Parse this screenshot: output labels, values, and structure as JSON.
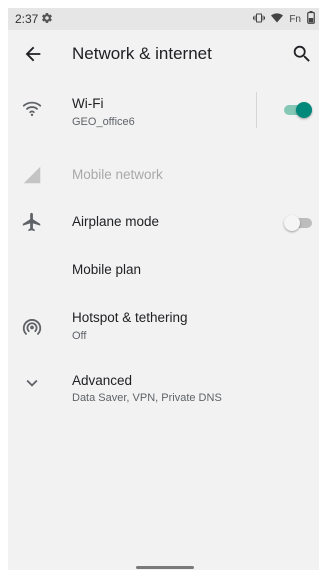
{
  "status_bar": {
    "time": "2:37",
    "settings_icon": "gear-icon",
    "vibrate_icon": "vibrate-icon",
    "wifi_icon": "wifi-icon",
    "fn_label": "Fn",
    "battery_icon": "battery-icon"
  },
  "app_bar": {
    "title": "Network & internet",
    "back_icon": "arrow-back-icon",
    "search_icon": "search-icon"
  },
  "items": [
    {
      "label": "Wi-Fi",
      "sub": "GEO_office6",
      "icon": "wifi-icon",
      "toggle": true,
      "accent": "#00897b"
    },
    {
      "label": "Mobile network",
      "icon": "cell-signal-icon",
      "disabled": true
    },
    {
      "label": "Airplane mode",
      "icon": "airplane-icon",
      "toggle": false
    },
    {
      "label": "Mobile plan"
    },
    {
      "label": "Hotspot & tethering",
      "sub": "Off",
      "icon": "hotspot-icon"
    },
    {
      "label": "Advanced",
      "sub": "Data Saver, VPN, Private DNS",
      "icon": "chevron-down-icon"
    }
  ]
}
